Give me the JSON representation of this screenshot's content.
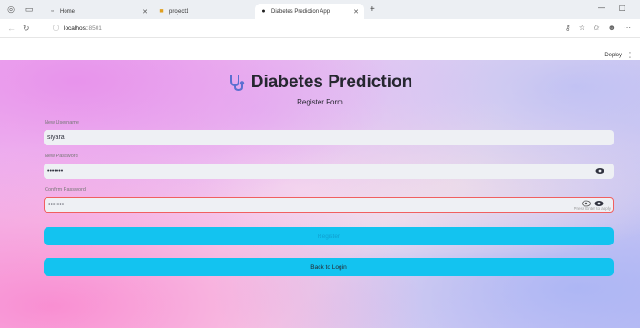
{
  "browser": {
    "tabs": [
      {
        "label": "Home"
      },
      {
        "label": "project1"
      },
      {
        "label": "Diabetes Prediction App"
      }
    ],
    "new_tab_icon": "plus-icon",
    "url_host": "localhost",
    "url_port": ":8501"
  },
  "app_header": {
    "deploy_label": "Deploy",
    "menu_icon": "⋮"
  },
  "page": {
    "title": "Diabetes Prediction",
    "subtitle": "Register Form",
    "title_icon": "stethoscope-icon"
  },
  "form": {
    "username": {
      "label": "New Username",
      "value": "siyara"
    },
    "password": {
      "label": "New Password",
      "value": "•••••••"
    },
    "confirm": {
      "label": "Confirm Password",
      "value": "•••••••",
      "hint": "Press Enter to apply"
    },
    "register_button": "Register",
    "back_button": "Back to Login"
  },
  "colors": {
    "button": "#13c3f0",
    "focus_border": "#f06060",
    "stethoscope": "#5b6fd1"
  }
}
